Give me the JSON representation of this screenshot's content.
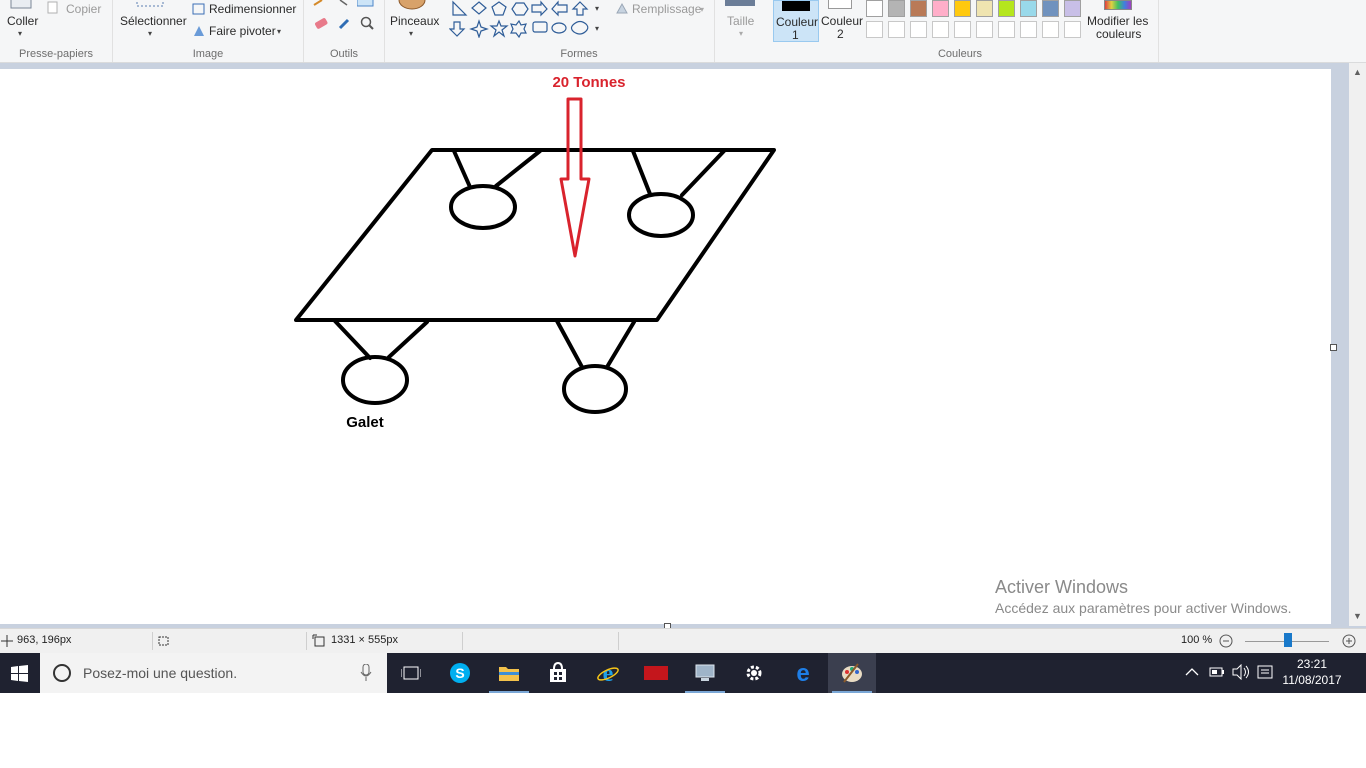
{
  "ribbon": {
    "clipboard": {
      "paste_label": "Coller",
      "copy_label": "Copier",
      "group_label": "Presse-papiers"
    },
    "image": {
      "select_label": "Sélectionner",
      "resize_label": "Redimensionner",
      "rotate_label": "Faire pivoter",
      "group_label": "Image"
    },
    "tools": {
      "group_label": "Outils"
    },
    "brushes": {
      "label": "Pinceaux"
    },
    "shapes": {
      "group_label": "Formes",
      "fill_label": "Remplissage"
    },
    "size": {
      "label": "Taille"
    },
    "colors": {
      "color1_line1": "Couleur",
      "color1_line2": "1",
      "color2_line1": "Couleur",
      "color2_line2": "2",
      "group_label": "Couleurs",
      "edit_line1": "Modifier les",
      "edit_line2": "couleurs",
      "palette_row1": [
        "#ffffff",
        "#b4b4b4",
        "#b97a57",
        "#ffaec9",
        "#ffc90e",
        "#efe4b0",
        "#b5e61d",
        "#99d9ea",
        "#7092be",
        "#c8bfe7"
      ]
    }
  },
  "drawing": {
    "label_weight": "20 Tonnes",
    "label_roller": "Galet",
    "arrow_color": "#d9232d"
  },
  "watermark": {
    "title": "Activer Windows",
    "subtitle": "Accédez aux paramètres pour activer Windows."
  },
  "status": {
    "cursor_pos": "963, 196px",
    "canvas_size": "1331 × 555px",
    "zoom": "100 %"
  },
  "taskbar": {
    "search_placeholder": "Posez-moi une question.",
    "time": "23:21",
    "date": "11/08/2017"
  }
}
